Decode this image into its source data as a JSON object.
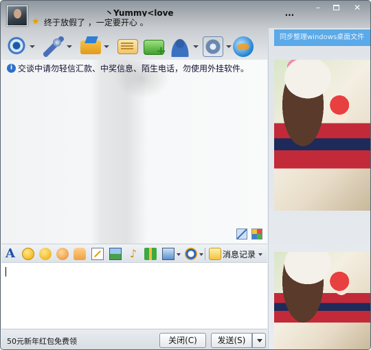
{
  "title_bar": {
    "nickname": "丶Yummy<love___________________________...",
    "signature": "终于放假了 ，一定要开心 。"
  },
  "window_controls": {
    "minimize": "–",
    "close": "✕"
  },
  "toolbar": {
    "icons": [
      "video-call-icon",
      "voice-call-icon",
      "send-file-icon",
      "send-mail-icon",
      "remote-assist-icon",
      "create-group-icon",
      "app-settings-icon",
      "qzone-icon"
    ]
  },
  "message_area": {
    "notice": "交谈中请勿轻信汇款、中奖信息、陌生电话，勿使用外挂软件。"
  },
  "format_bar": {
    "font_glyph": "A",
    "music_glyph": "♪",
    "history_label": "消息记录"
  },
  "bottom_bar": {
    "promo": "50元新年红包免费领",
    "close_button": "关闭(C)",
    "send_button": "发送(S)"
  },
  "side_panel": {
    "sync_link": "同步整理windows桌面文件"
  },
  "colors": {
    "accent": "#5aa9e8",
    "titlebar_dark": "#8e969e"
  }
}
